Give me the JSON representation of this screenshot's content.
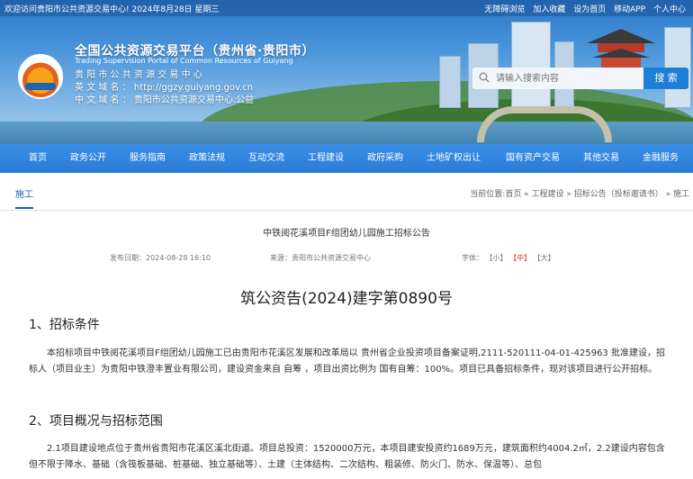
{
  "topbar": {
    "welcome": "欢迎访问贵阳市公共资源交易中心!  2024年8月28日 星期三",
    "links": [
      "无障碍浏览",
      "加入收藏",
      "设为首页",
      "移动APP",
      "个人中心"
    ]
  },
  "header": {
    "title": "全国公共资源交易平台（贵州省·贵阳市）",
    "subtitle_en": "Trading Supervision Portal of Common Resources of Guiyang",
    "info_lines": [
      "贵  阳  市  公  共  资  源  交  易  中  心",
      "英 文 域 名 ： http://ggzy.guiyang.gov.cn",
      "中 文 域 名 ： 贵阳市公共资源交易中心.公益"
    ]
  },
  "search": {
    "placeholder": "请输入搜索内容",
    "button_label": "搜 索"
  },
  "nav": {
    "items": [
      "首页",
      "政务公开",
      "服务指南",
      "政策法规",
      "互动交流",
      "工程建设",
      "政府采购",
      "土地矿权出让",
      "国有资产交易",
      "其他交易",
      "金融服务"
    ]
  },
  "breadcrumb": {
    "section": "施工",
    "path": "当前位置:首页 » 工程建设 » 招标公告（投标邀请书） » 施工"
  },
  "article": {
    "title": "中铁阅花溪项目F组团幼儿园施工招标公告",
    "publish_date": "发布日期：2024-08-28 16:10",
    "source": "来源：贵阳市公共资源交易中心",
    "font_label": "字体：",
    "font_small": "【小】",
    "font_medium": "【中】",
    "font_large": "【大】",
    "doc_number": "筑公资告(2024)建字第0890号",
    "section1_heading": "1、招标条件",
    "section1_text": "本招标项目中铁阅花溪项目F组团幼儿园施工已由贵阳市花溪区发展和改革局以 贵州省企业投资项目备案证明,2111-520111-04-01-425963 批准建设，招标人（项目业主）为贵阳中铁澄丰置业有限公司，建设资金来自 自筹 ，项目出资比例为 国有自筹：100%。项目已具备招标条件，现对该项目进行公开招标。",
    "section2_heading": "2、项目概况与招标范围",
    "section2_text": "2.1项目建设地点位于贵州省贵阳市花溪区溪北街道。项目总投资：1520000万元，本项目建安投资约1689万元，建筑面积约4004.2㎡，2.2建设内容包含但不限于降水、基础（含筏板基础、桩基础、独立基础等）、土建（主体结构、二次结构、粗装修、防火门、防水、保温等）、总包"
  },
  "colors": {
    "nav_blue": "#2a7bd6",
    "link_blue": "#1f5fa8",
    "font_medium_red": "#d33"
  }
}
